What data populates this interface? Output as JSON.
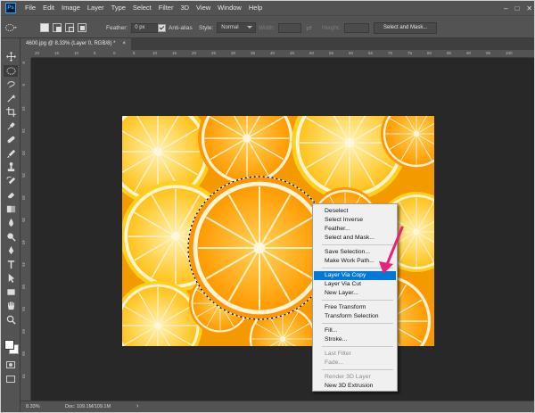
{
  "menubar": {
    "logo": "Ps",
    "items": [
      "File",
      "Edit",
      "Image",
      "Layer",
      "Type",
      "Select",
      "Filter",
      "3D",
      "View",
      "Window",
      "Help"
    ],
    "controls": {
      "minimize": "–",
      "maximize": "□",
      "close": "✕"
    }
  },
  "options": {
    "feather_label": "Feather:",
    "feather_value": "0 px",
    "antialias_label": "Anti-alias",
    "style_label": "Style:",
    "style_value": "Normal",
    "width_label": "Width:",
    "height_label": "Height:",
    "select_mask_button": "Select and Mask..."
  },
  "document": {
    "tab_title": "4600.jpg @ 8.33% (Layer 0, RGB/8) *",
    "tab_close": "×"
  },
  "rulers": {
    "top": [
      "20",
      "15",
      "10",
      "5",
      "0",
      "5",
      "10",
      "15",
      "20",
      "25",
      "30",
      "35",
      "40",
      "45",
      "50",
      "55",
      "60",
      "65",
      "70",
      "75",
      "80",
      "85",
      "90",
      "95",
      "100"
    ],
    "left": [
      "0",
      "5",
      "10",
      "15",
      "20",
      "25",
      "30",
      "35",
      "40",
      "45",
      "50",
      "55",
      "60",
      "65",
      "70"
    ]
  },
  "status": {
    "zoom": "8.33%",
    "doc": "Doc: 109.1M/109.1M"
  },
  "context_menu": {
    "groups": [
      [
        {
          "label": "Deselect",
          "state": "normal"
        },
        {
          "label": "Select Inverse",
          "state": "normal"
        },
        {
          "label": "Feather...",
          "state": "normal"
        },
        {
          "label": "Select and Mask...",
          "state": "normal"
        }
      ],
      [
        {
          "label": "Save Selection...",
          "state": "normal"
        },
        {
          "label": "Make Work Path...",
          "state": "normal"
        }
      ],
      [
        {
          "label": "Layer Via Copy",
          "state": "highlighted"
        },
        {
          "label": "Layer Via Cut",
          "state": "normal"
        },
        {
          "label": "New Layer...",
          "state": "normal"
        }
      ],
      [
        {
          "label": "Free Transform",
          "state": "normal"
        },
        {
          "label": "Transform Selection",
          "state": "normal"
        }
      ],
      [
        {
          "label": "Fill...",
          "state": "normal"
        },
        {
          "label": "Stroke...",
          "state": "normal"
        }
      ],
      [
        {
          "label": "Last Filter",
          "state": "disabled"
        },
        {
          "label": "Fade...",
          "state": "disabled"
        }
      ],
      [
        {
          "label": "Render 3D Layer",
          "state": "disabled"
        },
        {
          "label": "New 3D Extrusion",
          "state": "normal"
        }
      ]
    ]
  },
  "colors": {
    "ui_bg": "#535353",
    "canvas_bg": "#282828",
    "highlight": "#0078d7",
    "annotation_arrow": "#e8217a",
    "orange": "#ffa500"
  },
  "tools": [
    "move-icon",
    "elliptical-marquee-icon",
    "lasso-icon",
    "magic-wand-icon",
    "crop-icon",
    "eyedropper-icon",
    "healing-brush-icon",
    "brush-icon",
    "clone-stamp-icon",
    "history-brush-icon",
    "eraser-icon",
    "gradient-icon",
    "blur-icon",
    "dodge-icon",
    "pen-icon",
    "type-icon",
    "path-selection-icon",
    "rectangle-icon",
    "hand-icon",
    "zoom-icon"
  ]
}
